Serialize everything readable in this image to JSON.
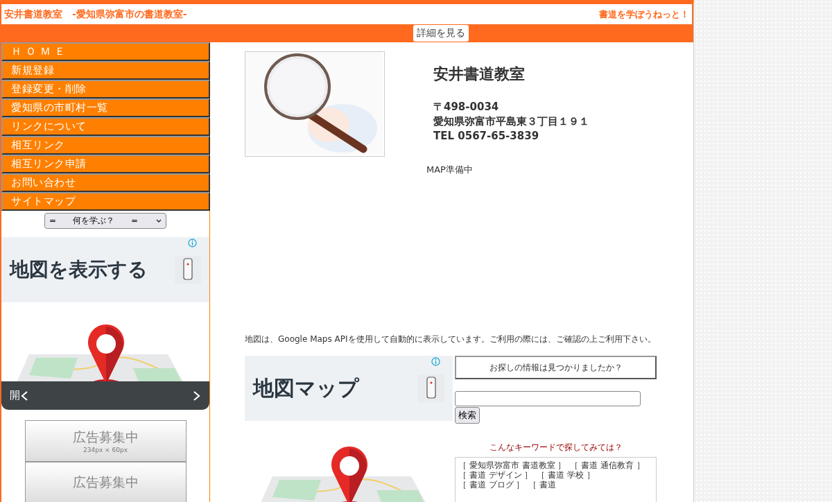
{
  "header": {
    "title": "安井書道教室　-愛知県弥富市の書道教室-",
    "slogan": "書道を学ぼうねっと！",
    "detail_button": "詳細を見る"
  },
  "sidebar": {
    "items": [
      {
        "label": "ＨＯＭＥ",
        "kind": "spaced"
      },
      {
        "label": "新規登録",
        "kind": "plain"
      },
      {
        "label": "登録変更・削除",
        "kind": "plain"
      },
      {
        "label": "愛知県の市町村一覧",
        "kind": "plain"
      },
      {
        "label": "リンクについて",
        "kind": "plain"
      },
      {
        "label": "相互リンク",
        "kind": "plain"
      },
      {
        "label": "相互リンク申請",
        "kind": "plain"
      },
      {
        "label": "お問い合わせ",
        "kind": "plain"
      },
      {
        "label": "サイトマップ",
        "kind": "plain"
      }
    ],
    "select": {
      "value": "=　　何を学ぶ？　　="
    },
    "ad": {
      "headline": "地図を表示する",
      "open_label": "開"
    },
    "banners": [
      {
        "text": "広告募集中",
        "size": "234px × 60px"
      },
      {
        "text": "広告募集中"
      }
    ]
  },
  "listing": {
    "name": "安井書道教室",
    "postal": "〒498-0034",
    "address": "愛知県弥富市平島東３丁目１９１",
    "tel": "TEL 0567-65-3839",
    "map_status": "MAP準備中",
    "map_note": "地図は、Google Maps APIを使用して自動的に表示しています。ご利用の際には、ご確認の上ご利用下さい。"
  },
  "content_ad": {
    "headline": "地図マップ"
  },
  "search": {
    "question": "お探しの情報は見つかりましたか？",
    "button": "検索"
  },
  "keywords": {
    "title": "こんなキーワードで探してみては？",
    "items": [
      "［ 愛知県弥富市 書道教室 ］",
      "［ 書道 通信教育 ］",
      "［ 書道 デザイン ］",
      "［ 書道 学校 ］",
      "［ 書道 ブログ ］",
      "［ 書道"
    ]
  }
}
